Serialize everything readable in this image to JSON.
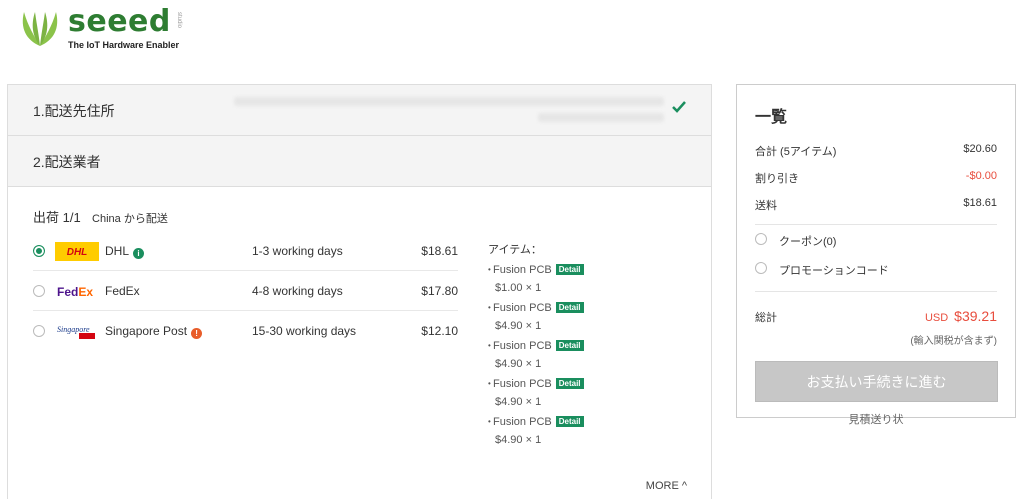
{
  "header": {
    "logo_text": "seeed",
    "logo_studio": "studio",
    "tagline": "The IoT Hardware Enabler"
  },
  "steps": {
    "address_title": "1.配送先住所",
    "carrier_title": "2.配送業者"
  },
  "shipment": {
    "label": "出荷 1/1",
    "from": "China から配送",
    "carriers": [
      {
        "name": "DHL",
        "days": "1-3 working days",
        "price": "$18.61",
        "selected": true,
        "icon": "info-green-icon"
      },
      {
        "name": "FedEx",
        "days": "4-8 working days",
        "price": "$17.80",
        "selected": false
      },
      {
        "name": "Singapore Post",
        "days": "15-30 working days",
        "price": "$12.10",
        "selected": false,
        "icon": "warning-orange-icon"
      }
    ],
    "items_label": "アイテム：",
    "items": [
      {
        "name": "Fusion PCB",
        "detail": "Detail",
        "price": "$1.00 × 1"
      },
      {
        "name": "Fusion PCB",
        "detail": "Detail",
        "price": "$4.90 × 1"
      },
      {
        "name": "Fusion PCB",
        "detail": "Detail",
        "price": "$4.90 × 1"
      },
      {
        "name": "Fusion PCB",
        "detail": "Detail",
        "price": "$4.90 × 1"
      },
      {
        "name": "Fusion PCB",
        "detail": "Detail",
        "price": "$4.90 × 1"
      }
    ],
    "more": "MORE ^"
  },
  "summary": {
    "title": "一覧",
    "subtotal_label": "合計 (5アイテム)",
    "subtotal": "$20.60",
    "discount_label": "割り引き",
    "discount": "-$0.00",
    "shipping_label": "送料",
    "shipping": "$18.61",
    "coupon_label": "クーポン(0)",
    "promo_label": "プロモーションコード",
    "total_label": "総計",
    "total_currency": "USD",
    "total": "$39.21",
    "tax_note": "(輸入関税が含まず)",
    "pay_button": "お支払い手続きに進む",
    "quote_link": "見積送り状"
  },
  "colors": {
    "accent": "#1a8e5e",
    "price_red": "#e84d3d",
    "logo_green": "#2e7d32"
  }
}
